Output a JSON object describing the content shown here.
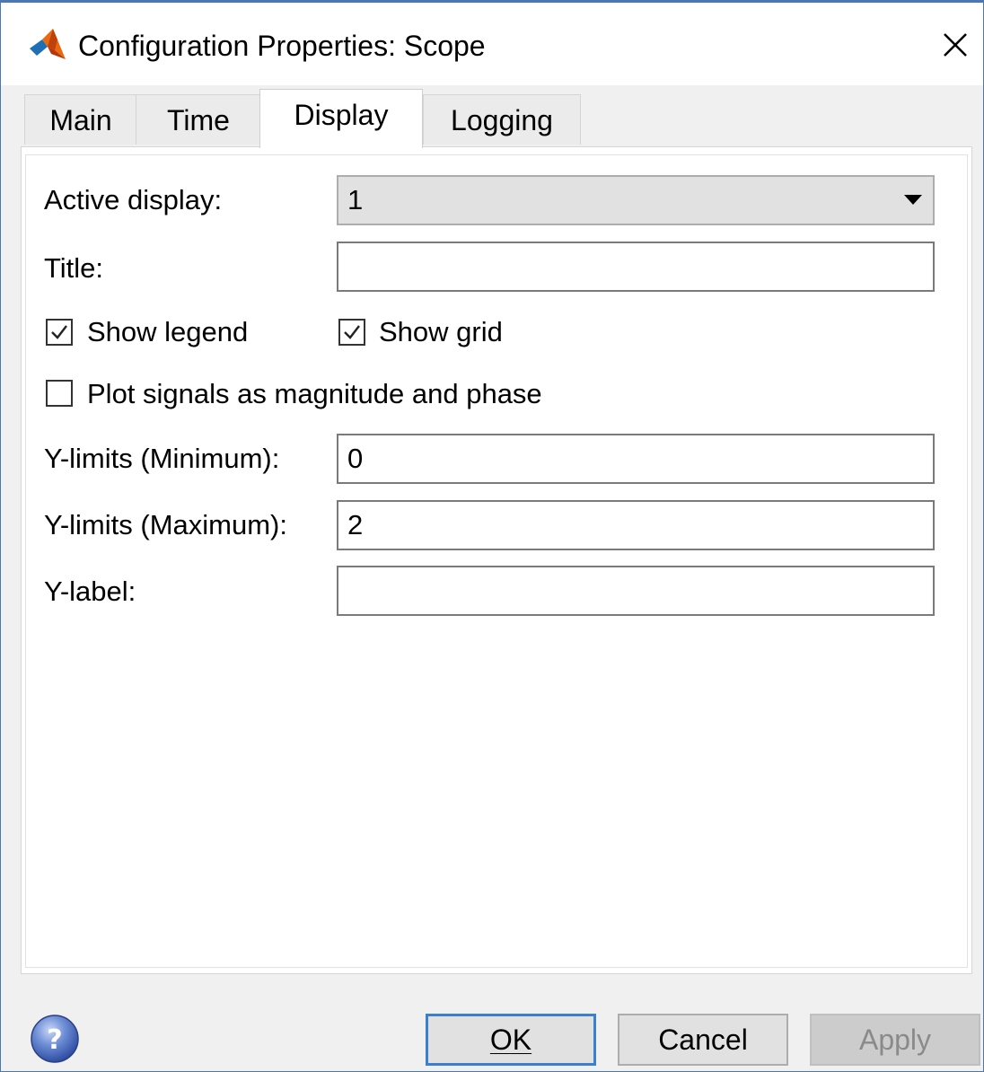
{
  "window": {
    "title": "Configuration Properties: Scope",
    "app_icon": "matlab-logo-icon",
    "close_icon": "close-icon"
  },
  "tabs": [
    {
      "label": "Main",
      "active": false
    },
    {
      "label": "Time",
      "active": false
    },
    {
      "label": "Display",
      "active": true
    },
    {
      "label": "Logging",
      "active": false
    }
  ],
  "display": {
    "active_display_label": "Active display:",
    "active_display_value": "1",
    "title_label": "Title:",
    "title_value": "",
    "show_legend_label": "Show legend",
    "show_legend_checked": true,
    "show_grid_label": "Show grid",
    "show_grid_checked": true,
    "mag_phase_label": "Plot signals as magnitude and phase",
    "mag_phase_checked": false,
    "ymin_label": "Y-limits (Minimum):",
    "ymin_value": "0",
    "ymax_label": "Y-limits (Maximum):",
    "ymax_value": "2",
    "ylabel_label": "Y-label:",
    "ylabel_value": ""
  },
  "footer": {
    "help_icon": "help-icon",
    "ok_label": "OK",
    "cancel_label": "Cancel",
    "apply_label": "Apply",
    "apply_enabled": false
  },
  "colors": {
    "window_border": "#4a78b5",
    "default_button_border": "#3c7fd0",
    "panel_bg": "#ffffff",
    "dialog_bg": "#f0f0f0"
  }
}
